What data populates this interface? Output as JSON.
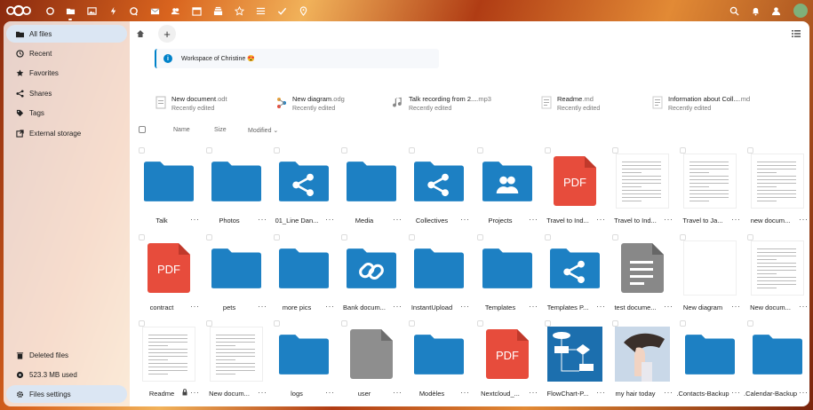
{
  "colors": {
    "accent": "#0082c9",
    "folder": "#1d80c3",
    "pdf": "#e74c3c",
    "generic_file": "#888888",
    "nav_active": "#dbe6f3"
  },
  "topbar": {
    "apps": [
      "dashboard-icon",
      "files-icon",
      "photos-icon",
      "activity-icon",
      "talk-icon",
      "mail-icon",
      "contacts-icon",
      "calendar-icon",
      "deck-icon",
      "favorites-icon",
      "tasks-icon",
      "checkmark-icon",
      "maps-icon"
    ],
    "right_icons": [
      "search-icon",
      "notifications-icon",
      "contacts-menu-icon",
      "user-avatar"
    ]
  },
  "sidebar": {
    "items": [
      {
        "label": "All files",
        "icon": "folder-icon"
      },
      {
        "label": "Recent",
        "icon": "clock-icon"
      },
      {
        "label": "Favorites",
        "icon": "star-icon"
      },
      {
        "label": "Shares",
        "icon": "share-icon"
      },
      {
        "label": "Tags",
        "icon": "tag-icon"
      },
      {
        "label": "External storage",
        "icon": "external-icon"
      }
    ],
    "footer": [
      {
        "label": "Deleted files",
        "icon": "trash-icon"
      },
      {
        "label": "523.3 MB used",
        "icon": "storage-icon"
      },
      {
        "label": "Files settings",
        "icon": "gear-icon"
      }
    ]
  },
  "main": {
    "rich_workspace": "Workspace of Christine 😍",
    "recent_files": [
      {
        "name": "New document",
        "ext": ".odt",
        "sub": "Recently edited",
        "icon": "document-icon"
      },
      {
        "name": "New diagram",
        "ext": ".odg",
        "sub": "Recently edited",
        "icon": "diagram-icon"
      },
      {
        "name": "Talk recording from 2...",
        "ext": ".mp3",
        "sub": "Recently edited",
        "icon": "audio-icon"
      },
      {
        "name": "Readme",
        "ext": ".md",
        "sub": "Recently edited",
        "icon": "markdown-icon"
      },
      {
        "name": "Information about Coll...",
        "ext": ".md",
        "sub": "Recently edited",
        "icon": "markdown-icon"
      }
    ],
    "columns": {
      "name": "Name",
      "size": "Size",
      "modified": "Modified"
    },
    "files": [
      {
        "name": "Talk",
        "type": "folder"
      },
      {
        "name": "Photos",
        "type": "folder"
      },
      {
        "name": "01_Line Dan...",
        "type": "shared-folder"
      },
      {
        "name": "Media",
        "type": "folder"
      },
      {
        "name": "Collectives",
        "type": "shared-folder"
      },
      {
        "name": "Projects",
        "type": "group-folder"
      },
      {
        "name": "Travel to Ind...",
        "type": "pdf"
      },
      {
        "name": "Travel to Ind...",
        "type": "doc"
      },
      {
        "name": "Travel to Ja...",
        "type": "doc"
      },
      {
        "name": "new docum...",
        "type": "doc"
      },
      {
        "name": "contract",
        "type": "pdf"
      },
      {
        "name": "pets",
        "type": "folder"
      },
      {
        "name": "more pics",
        "type": "folder"
      },
      {
        "name": "Bank docum...",
        "type": "link-folder"
      },
      {
        "name": "InstantUpload",
        "type": "folder"
      },
      {
        "name": "Templates",
        "type": "folder"
      },
      {
        "name": "Templates P...",
        "type": "shared-folder"
      },
      {
        "name": "test docume...",
        "type": "text-file"
      },
      {
        "name": "New diagram",
        "type": "blank"
      },
      {
        "name": "New docum...",
        "type": "doc"
      },
      {
        "name": "Readme",
        "type": "doc",
        "locked": true
      },
      {
        "name": "New docum...",
        "type": "doc"
      },
      {
        "name": "logs",
        "type": "folder"
      },
      {
        "name": "user",
        "type": "generic-file"
      },
      {
        "name": "Modèles",
        "type": "folder"
      },
      {
        "name": "Nextcloud_...",
        "type": "pdf"
      },
      {
        "name": "FlowChart-P...",
        "type": "image-flowchart"
      },
      {
        "name": "my hair today",
        "type": "image-photo"
      },
      {
        "name": ".Contacts-Backup",
        "type": "folder"
      },
      {
        "name": ".Calendar-Backup",
        "type": "folder"
      }
    ],
    "pdf_label": "PDF"
  }
}
